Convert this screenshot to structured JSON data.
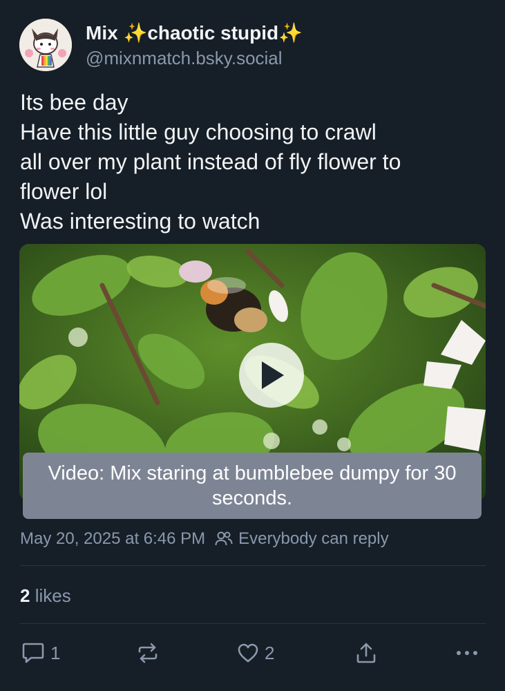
{
  "author": {
    "display_name": "Mix ✨chaotic stupid✨",
    "handle": "@mixnmatch.bsky.social",
    "avatar": "avatar-icon"
  },
  "post": {
    "lines": [
      "Its bee day",
      "Have this little guy choosing to crawl",
      "all over my plant instead of fly flower to",
      "flower lol",
      "Was interesting to watch"
    ]
  },
  "video": {
    "caption": "Video: Mix staring at bumblebee dumpy for 30 seconds.",
    "play_icon": "play-icon"
  },
  "meta": {
    "timestamp": "May 20, 2025 at 6:46 PM",
    "reply_setting": "Everybody can reply"
  },
  "stats": {
    "likes_count": "2",
    "likes_label": "likes"
  },
  "actions": {
    "reply_count": "1",
    "like_count": "2"
  },
  "colors": {
    "background": "#161e27",
    "muted_text": "#8a99ad",
    "caption_bg": "#7d8595"
  }
}
